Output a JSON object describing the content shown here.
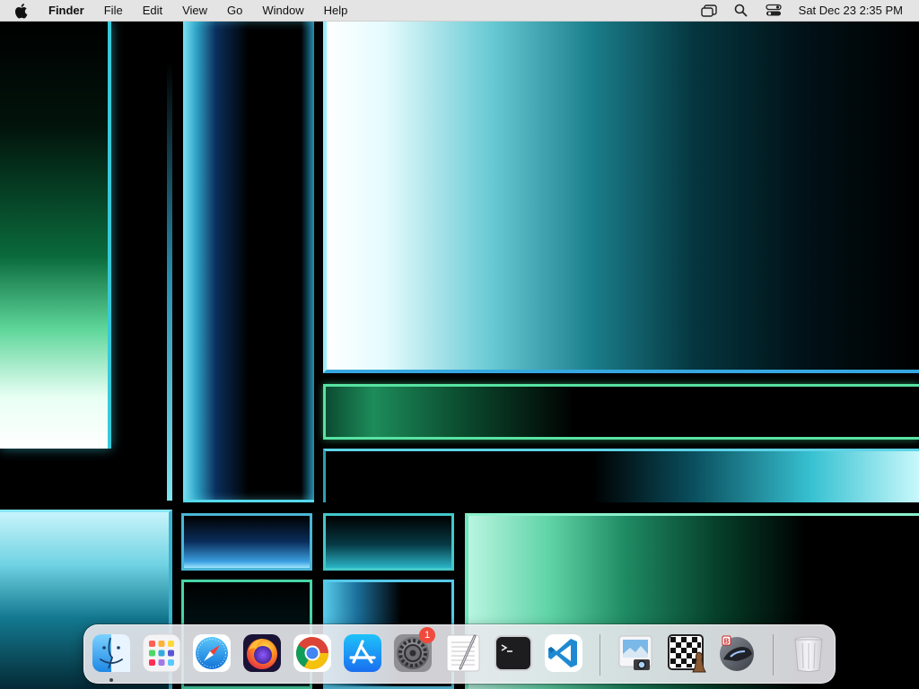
{
  "menubar": {
    "apple_icon": "apple-logo-icon",
    "app_name": "Finder",
    "menus": [
      "File",
      "Edit",
      "View",
      "Go",
      "Window",
      "Help"
    ],
    "status_icons": [
      "screen-mirroring-icon",
      "spotlight-search-icon",
      "control-center-icon"
    ],
    "clock": "Sat Dec 23  2:35 PM"
  },
  "dock": {
    "apps": [
      {
        "name": "Finder",
        "icon": "finder-icon",
        "running": true
      },
      {
        "name": "Launchpad",
        "icon": "launchpad-icon"
      },
      {
        "name": "Safari",
        "icon": "safari-icon"
      },
      {
        "name": "Firefox",
        "icon": "firefox-icon"
      },
      {
        "name": "Chrome",
        "icon": "chrome-icon"
      },
      {
        "name": "App Store",
        "icon": "app-store-icon"
      },
      {
        "name": "System Settings",
        "icon": "system-settings-icon",
        "badge": "1"
      },
      {
        "name": "TextEdit",
        "icon": "textedit-icon"
      },
      {
        "name": "Terminal",
        "icon": "terminal-icon"
      },
      {
        "name": "Visual Studio Code",
        "icon": "vscode-icon"
      }
    ],
    "extra": [
      {
        "name": "Preview",
        "icon": "preview-icon"
      },
      {
        "name": "Chess",
        "icon": "chess-icon"
      },
      {
        "name": "Automator",
        "icon": "automator-icon"
      }
    ],
    "trash": {
      "name": "Trash",
      "icon": "trash-icon"
    }
  },
  "colors": {
    "menubar_bg": "#e4e4e4",
    "badge": "#f04a3c",
    "vscode_blue": "#1f8ad2",
    "finder_blue": "#3ea6f5"
  }
}
